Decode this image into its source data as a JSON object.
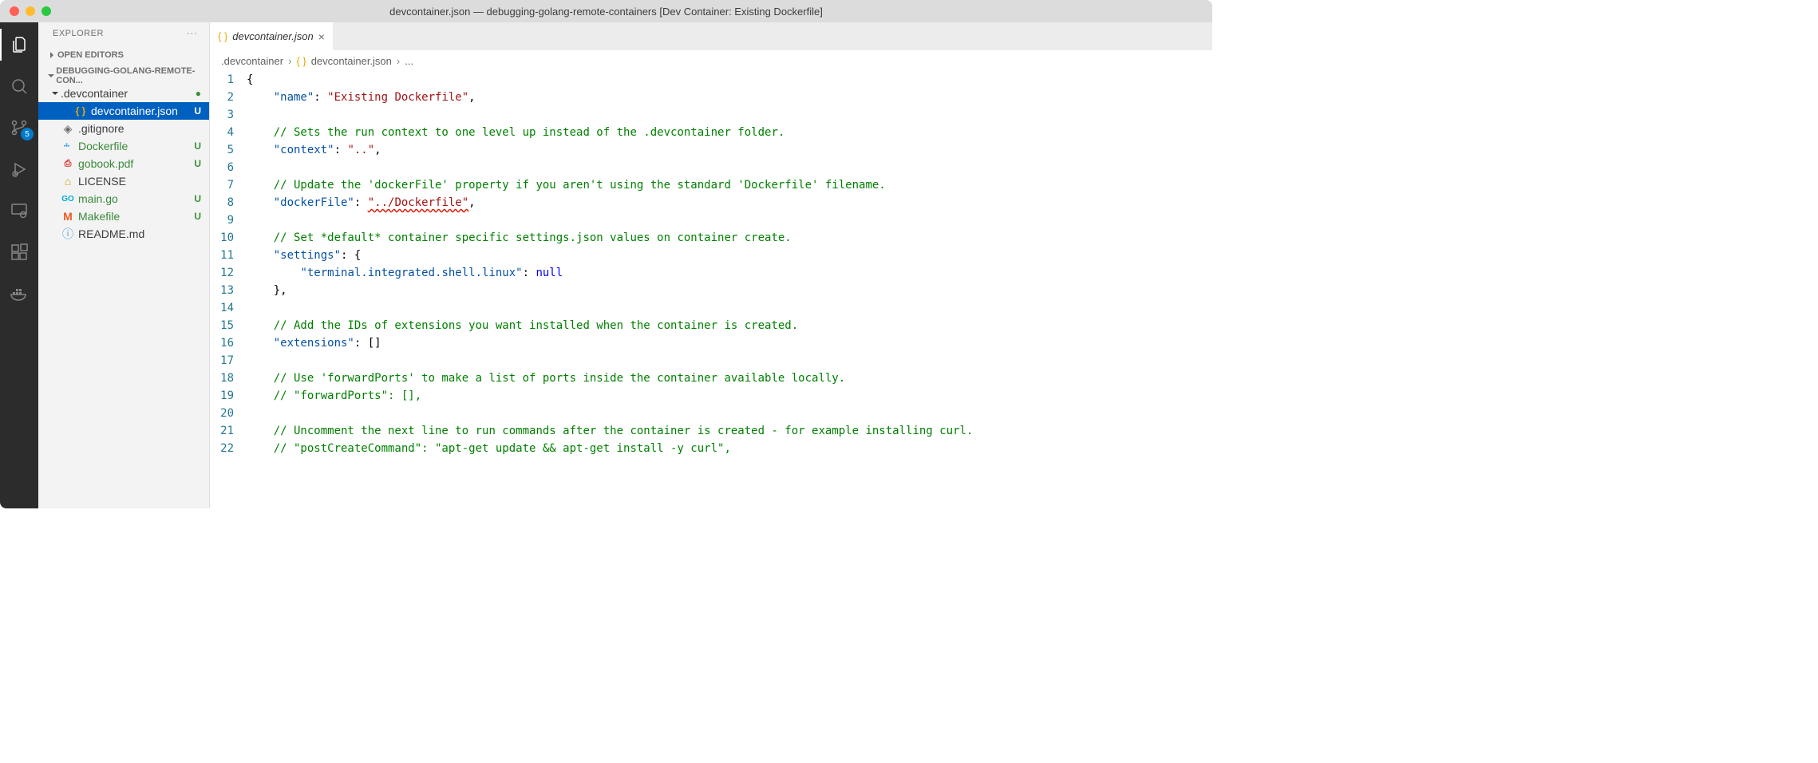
{
  "window": {
    "title": "devcontainer.json — debugging-golang-remote-containers [Dev Container: Existing Dockerfile]"
  },
  "activityBar": {
    "badgeCount": "5"
  },
  "sidebar": {
    "title": "EXPLORER",
    "openEditors": "OPEN EDITORS",
    "projectName": "DEBUGGING-GOLANG-REMOTE-CON...",
    "tree": [
      {
        "label": ".devcontainer",
        "type": "folder",
        "status": "●",
        "expanded": true,
        "depth": 1
      },
      {
        "label": "devcontainer.json",
        "type": "json",
        "status": "U",
        "selected": true,
        "depth": 2
      },
      {
        "label": ".gitignore",
        "type": "gitignore",
        "status": "",
        "depth": 1
      },
      {
        "label": "Dockerfile",
        "type": "docker",
        "status": "U",
        "gitmod": true,
        "depth": 1
      },
      {
        "label": "gobook.pdf",
        "type": "pdf",
        "status": "U",
        "gitmod": true,
        "depth": 1
      },
      {
        "label": "LICENSE",
        "type": "license",
        "status": "",
        "depth": 1
      },
      {
        "label": "main.go",
        "type": "go",
        "status": "U",
        "gitmod": true,
        "depth": 1
      },
      {
        "label": "Makefile",
        "type": "makefile",
        "status": "U",
        "gitmod": true,
        "depth": 1
      },
      {
        "label": "README.md",
        "type": "readme",
        "status": "",
        "depth": 1
      }
    ]
  },
  "tabs": {
    "active": {
      "label": "devcontainer.json"
    }
  },
  "breadcrumbs": {
    "parts": [
      ".devcontainer",
      "devcontainer.json",
      "..."
    ]
  },
  "code": {
    "lines": [
      {
        "n": 1,
        "t": [
          [
            "brace",
            "{"
          ]
        ]
      },
      {
        "n": 2,
        "t": [
          [
            "indent",
            "    "
          ],
          [
            "key",
            "\"name\""
          ],
          [
            "punc",
            ": "
          ],
          [
            "str",
            "\"Existing Dockerfile\""
          ],
          [
            "punc",
            ","
          ]
        ]
      },
      {
        "n": 3,
        "t": []
      },
      {
        "n": 4,
        "t": [
          [
            "indent",
            "    "
          ],
          [
            "comment",
            "// Sets the run context to one level up instead of the .devcontainer folder."
          ]
        ]
      },
      {
        "n": 5,
        "t": [
          [
            "indent",
            "    "
          ],
          [
            "key",
            "\"context\""
          ],
          [
            "punc",
            ": "
          ],
          [
            "str",
            "\"..\""
          ],
          [
            "punc",
            ","
          ]
        ]
      },
      {
        "n": 6,
        "t": []
      },
      {
        "n": 7,
        "t": [
          [
            "indent",
            "    "
          ],
          [
            "comment",
            "// Update the 'dockerFile' property if you aren't using the standard 'Dockerfile' filename."
          ]
        ]
      },
      {
        "n": 8,
        "t": [
          [
            "indent",
            "    "
          ],
          [
            "key",
            "\"dockerFile\""
          ],
          [
            "punc",
            ": "
          ],
          [
            "str-err",
            "\"../Dockerfile\""
          ],
          [
            "punc",
            ","
          ]
        ]
      },
      {
        "n": 9,
        "t": []
      },
      {
        "n": 10,
        "t": [
          [
            "indent",
            "    "
          ],
          [
            "comment",
            "// Set *default* container specific settings.json values on container create."
          ]
        ]
      },
      {
        "n": 11,
        "t": [
          [
            "indent",
            "    "
          ],
          [
            "key",
            "\"settings\""
          ],
          [
            "punc",
            ": "
          ],
          [
            "brace",
            "{"
          ]
        ]
      },
      {
        "n": 12,
        "t": [
          [
            "indent",
            "        "
          ],
          [
            "key",
            "\"terminal.integrated.shell.linux\""
          ],
          [
            "punc",
            ": "
          ],
          [
            "null",
            "null"
          ]
        ]
      },
      {
        "n": 13,
        "t": [
          [
            "indent",
            "    "
          ],
          [
            "brace",
            "}"
          ],
          [
            "punc",
            ","
          ]
        ]
      },
      {
        "n": 14,
        "t": []
      },
      {
        "n": 15,
        "t": [
          [
            "indent",
            "    "
          ],
          [
            "comment",
            "// Add the IDs of extensions you want installed when the container is created."
          ]
        ]
      },
      {
        "n": 16,
        "t": [
          [
            "indent",
            "    "
          ],
          [
            "key",
            "\"extensions\""
          ],
          [
            "punc",
            ": []"
          ]
        ]
      },
      {
        "n": 17,
        "t": []
      },
      {
        "n": 18,
        "t": [
          [
            "indent",
            "    "
          ],
          [
            "comment",
            "// Use 'forwardPorts' to make a list of ports inside the container available locally."
          ]
        ]
      },
      {
        "n": 19,
        "t": [
          [
            "indent",
            "    "
          ],
          [
            "comment",
            "// \"forwardPorts\": [],"
          ]
        ]
      },
      {
        "n": 20,
        "t": []
      },
      {
        "n": 21,
        "t": [
          [
            "indent",
            "    "
          ],
          [
            "comment",
            "// Uncomment the next line to run commands after the container is created - for example installing curl."
          ]
        ]
      },
      {
        "n": 22,
        "t": [
          [
            "indent",
            "    "
          ],
          [
            "comment",
            "// \"postCreateCommand\": \"apt-get update && apt-get install -y curl\","
          ]
        ]
      }
    ]
  }
}
